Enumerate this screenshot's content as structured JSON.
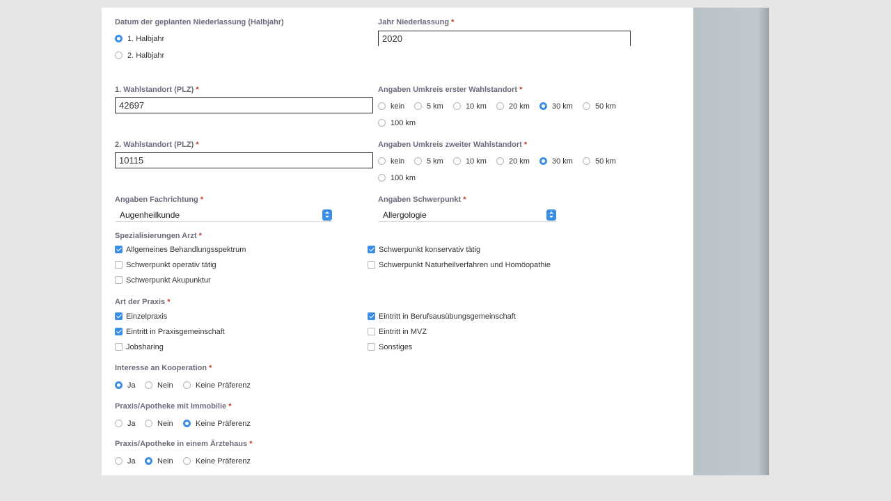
{
  "planned_date": {
    "label": "Datum der geplanten Niederlassung (Halbjahr)",
    "options": [
      "1. Halbjahr",
      "2. Halbjahr"
    ]
  },
  "year": {
    "label": "Jahr Niederlassung",
    "value": "2020"
  },
  "required_mark": "*",
  "location1": {
    "label": "1. Wahlstandort (PLZ)",
    "value": "42697"
  },
  "radius1": {
    "label": "Angaben Umkreis erster Wahlstandort"
  },
  "location2": {
    "label": "2. Wahlstandort (PLZ)",
    "value": "10115"
  },
  "radius2": {
    "label": "Angaben Umkreis zweiter Wahlstandort"
  },
  "radius_options": [
    "kein",
    "5 km",
    "10 km",
    "20 km",
    "30 km",
    "50 km",
    "100 km"
  ],
  "specialty": {
    "label": "Angaben Fachrichtung",
    "value": "Augenheilkunde"
  },
  "focus": {
    "label": "Angaben Schwerpunkt",
    "value": "Allergologie"
  },
  "specializations": {
    "label": "Spezialisierungen Arzt",
    "items": [
      "Allgemeines Behandlungsspektrum",
      "Schwerpunkt konservativ tätig",
      "Schwerpunkt operativ tätig",
      "Schwerpunkt Naturheilverfahren und Homöopathie",
      "Schwerpunkt Akupunktur"
    ]
  },
  "practice_type": {
    "label": "Art der Praxis",
    "items": [
      "Einzelpraxis",
      "Eintritt in Berufsausübungsgemeinschaft",
      "Eintritt in Praxisgemeinschaft",
      "Eintritt in MVZ",
      "Jobsharing",
      "Sonstiges"
    ]
  },
  "cooperation": {
    "label": "Interesse an Kooperation"
  },
  "real_estate": {
    "label": "Praxis/Apotheke mit Immobilie"
  },
  "doctors_house": {
    "label": "Praxis/Apotheke in einem Ärztehaus"
  },
  "yes_no_options": [
    "Ja",
    "Nein",
    "Keine Präferenz"
  ],
  "colors": {
    "accent": "#3a8ee6",
    "required": "#c0392b"
  }
}
